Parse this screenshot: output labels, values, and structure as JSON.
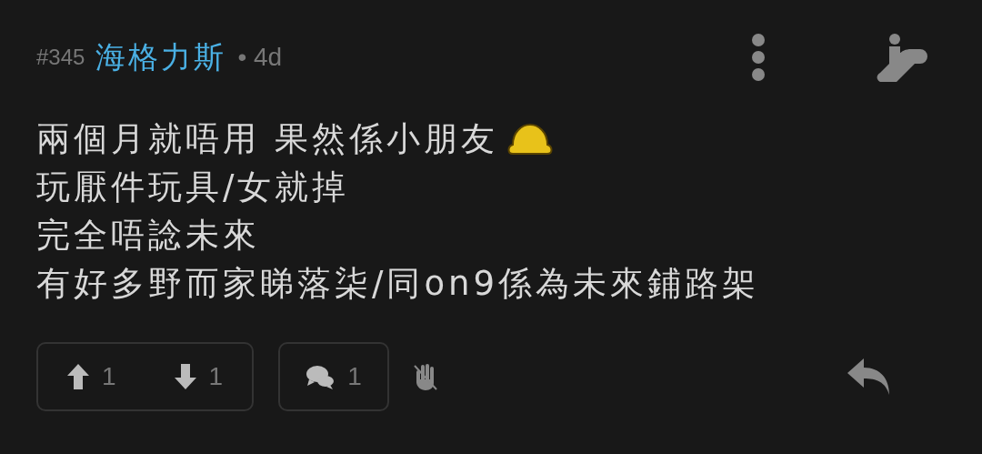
{
  "post": {
    "number": "#345",
    "author": "海格力斯",
    "separator": "•",
    "age": "4d"
  },
  "body": [
    {
      "text": "兩個月就唔用 果然係小朋友",
      "emoji": true
    },
    {
      "text": "玩厭件玩具/女就掉",
      "emoji": false
    },
    {
      "text": "完全唔諗未來",
      "emoji": false
    },
    {
      "text": "有好多野而家睇落柒/同on9係為未來鋪路架",
      "emoji": false
    }
  ],
  "votes": {
    "up": "1",
    "down": "1"
  },
  "comments": "1"
}
